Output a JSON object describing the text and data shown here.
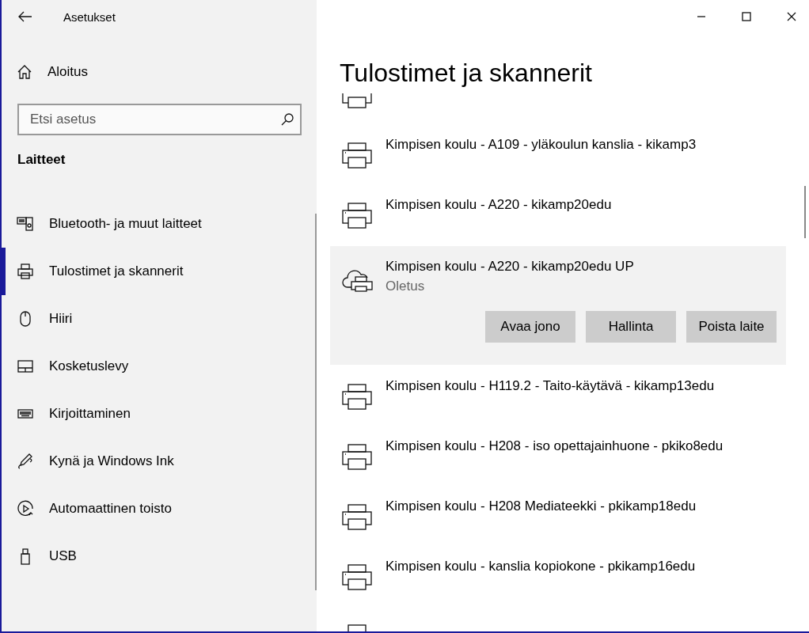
{
  "window": {
    "title": "Asetukset"
  },
  "sidebar": {
    "home": {
      "label": "Aloitus"
    },
    "search": {
      "placeholder": "Etsi asetus"
    },
    "section": "Laitteet",
    "items": [
      {
        "label": "Bluetooth- ja muut laitteet",
        "selected": false
      },
      {
        "label": "Tulostimet ja skannerit",
        "selected": true
      },
      {
        "label": "Hiiri",
        "selected": false
      },
      {
        "label": "Kosketuslevy",
        "selected": false
      },
      {
        "label": "Kirjoittaminen",
        "selected": false
      },
      {
        "label": "Kynä ja Windows Ink",
        "selected": false
      },
      {
        "label": "Automaattinen toisto",
        "selected": false
      },
      {
        "label": "USB",
        "selected": false
      }
    ]
  },
  "page": {
    "heading": "Tulostimet ja skannerit",
    "printers": [
      {
        "kind": "local",
        "expanded": false
      },
      {
        "kind": "local",
        "name": "Kimpisen koulu - A109 - yläkoulun kanslia - kikamp3",
        "expanded": false
      },
      {
        "kind": "local",
        "name": "Kimpisen koulu - A220 - kikamp20edu",
        "expanded": false
      },
      {
        "kind": "cloud",
        "name": "Kimpisen koulu - A220 - kikamp20edu UP",
        "status": "Oletus",
        "expanded": true,
        "buttons": [
          "Avaa jono",
          "Hallinta",
          "Poista laite"
        ]
      },
      {
        "kind": "local",
        "name": "Kimpisen koulu - H119.2 - Taito-käytävä - kikamp13edu",
        "expanded": false
      },
      {
        "kind": "local",
        "name": "Kimpisen koulu - H208 - iso opettajainhuone - pkiko8edu",
        "expanded": false
      },
      {
        "kind": "local",
        "name": "Kimpisen koulu - H208 Mediateekki - pkikamp18edu",
        "expanded": false
      },
      {
        "kind": "local",
        "name": "Kimpisen koulu - kanslia kopiokone - pkikamp16edu",
        "expanded": false
      },
      {
        "kind": "local",
        "expanded": false
      }
    ]
  }
}
